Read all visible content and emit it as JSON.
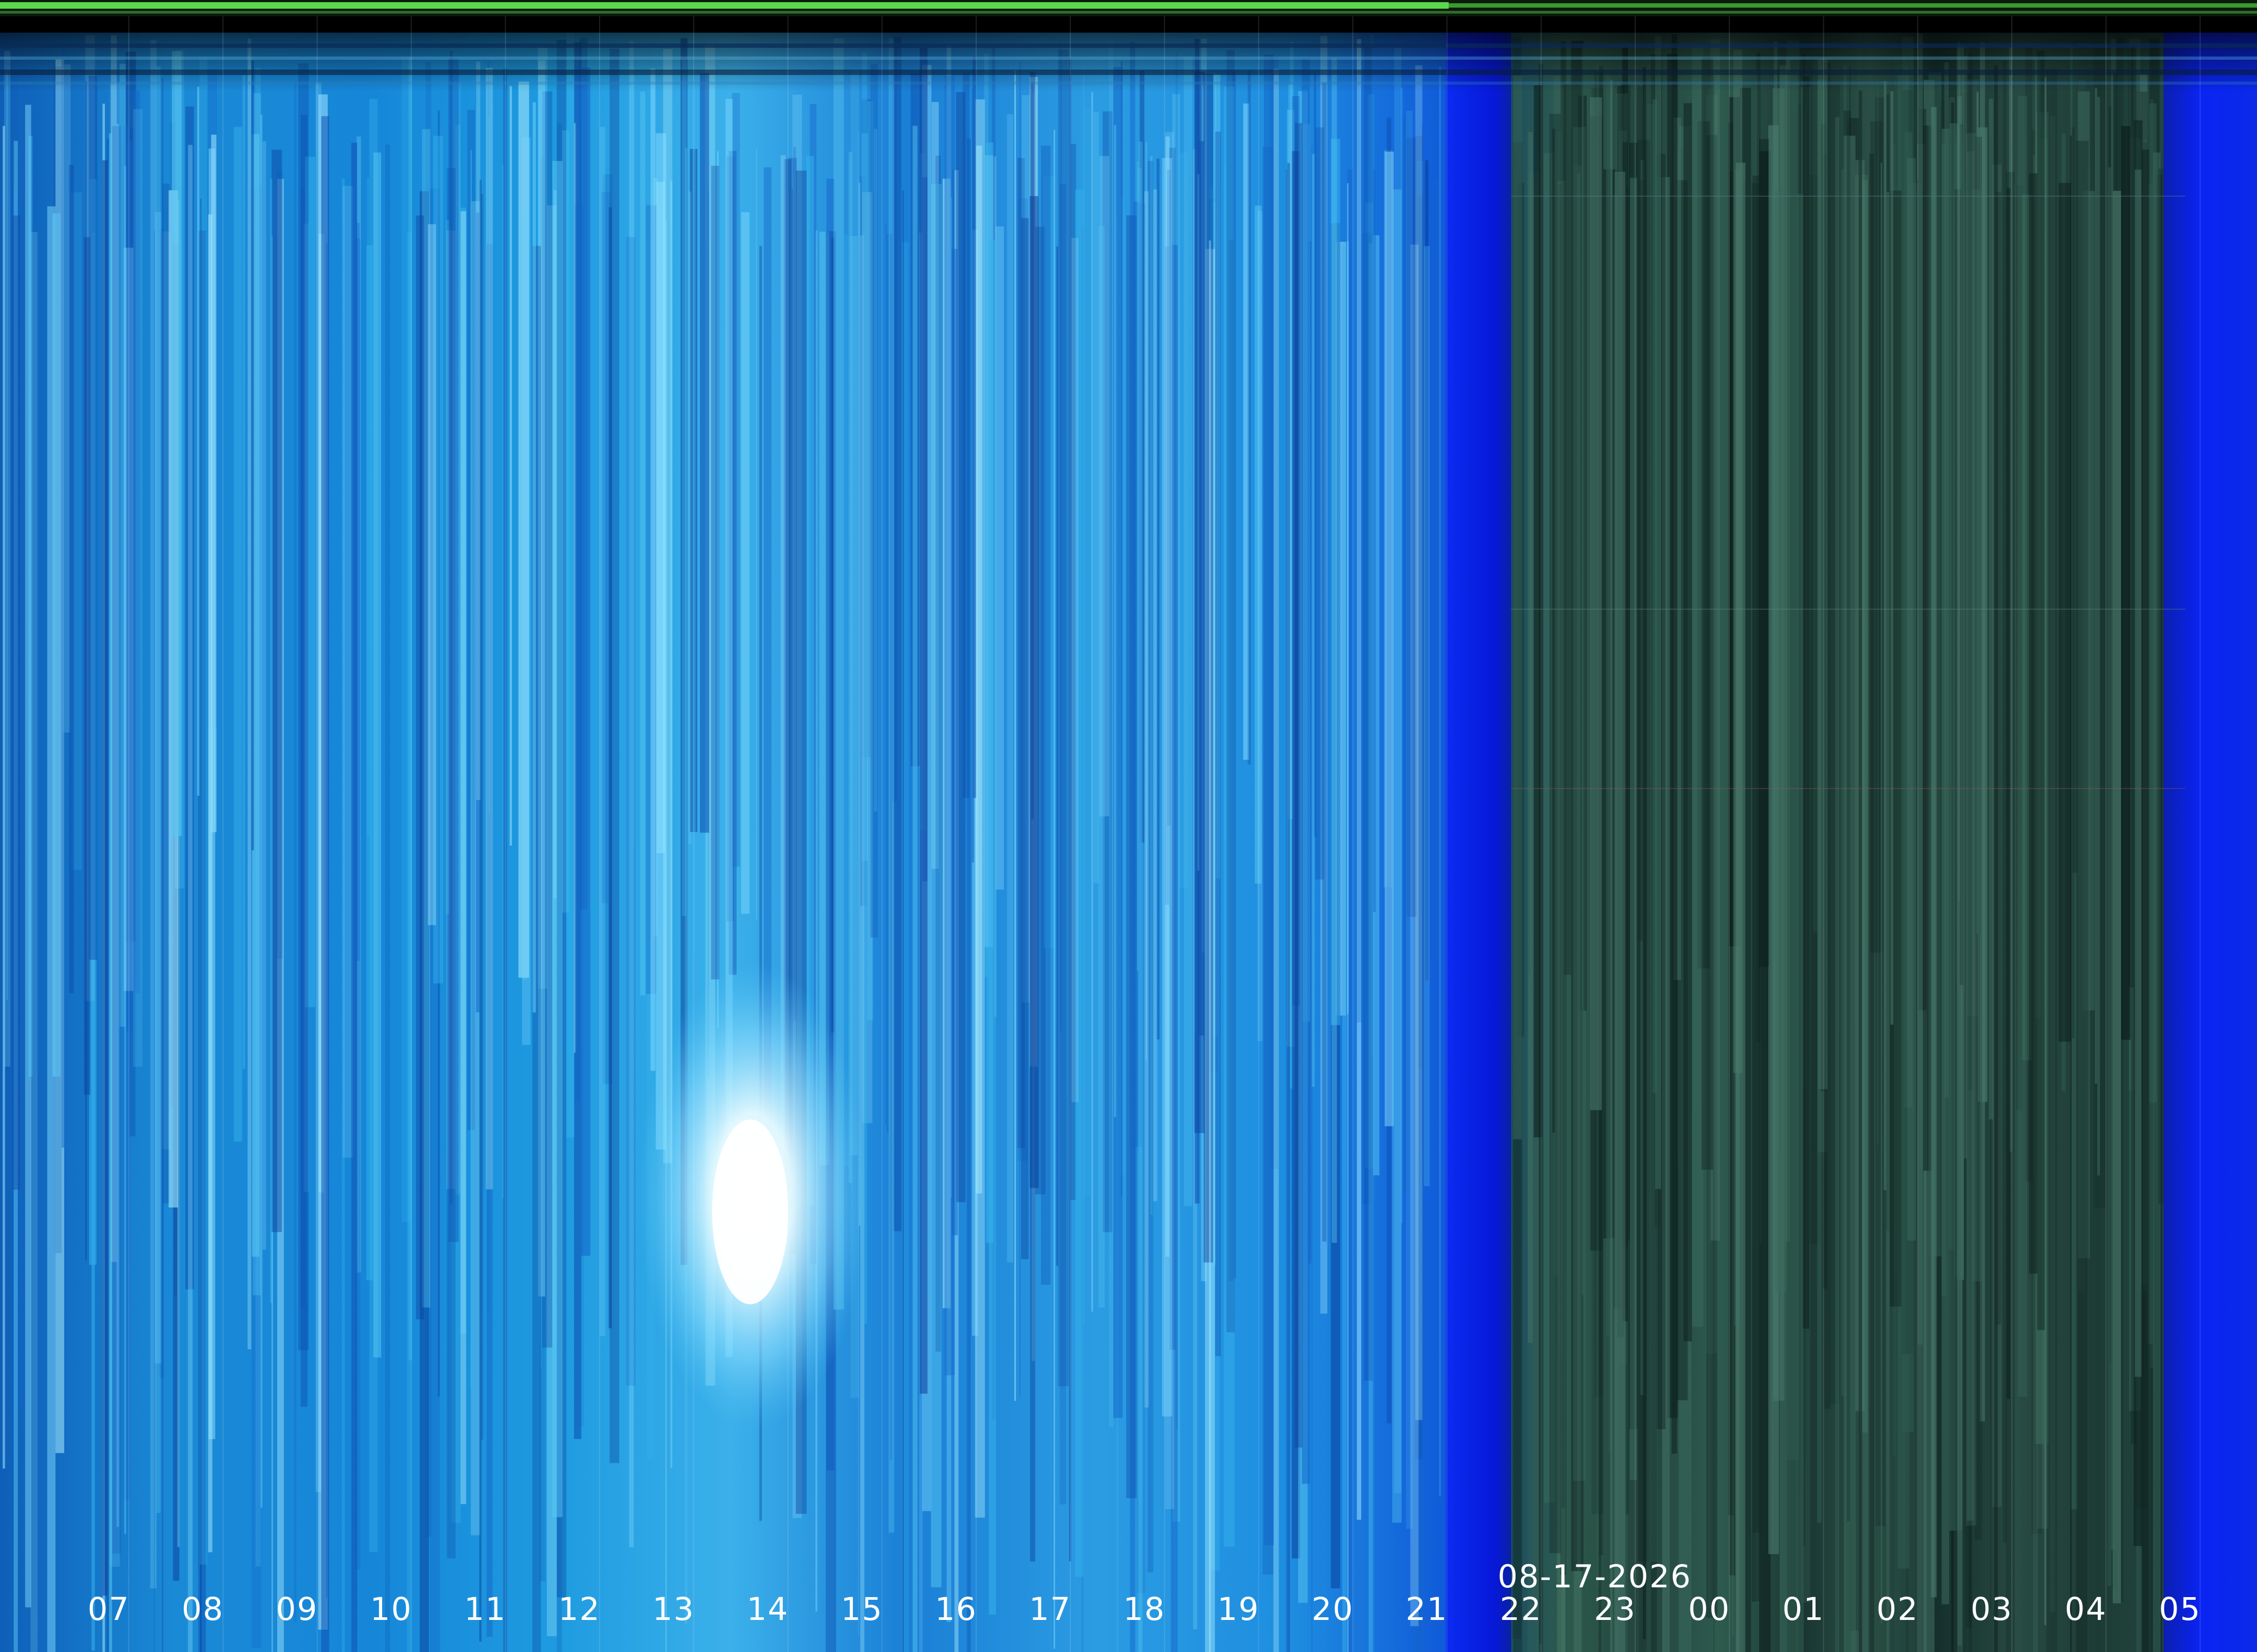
{
  "image": {
    "kind": "keogram",
    "date": "08-17-2026",
    "hour_labels": [
      "07",
      "08",
      "09",
      "10",
      "11",
      "12",
      "13",
      "14",
      "15",
      "16",
      "17",
      "18",
      "19",
      "20",
      "21",
      "22",
      "23",
      "00",
      "01",
      "02",
      "03",
      "04",
      "05"
    ],
    "colors": {
      "day_sky": "#1f8fe0",
      "day_highlight": "#9fe9ff",
      "twilight_blue": "#0a1fe6",
      "night_sky": "#1f3a33",
      "status_bar_green": "#58d84a"
    }
  }
}
